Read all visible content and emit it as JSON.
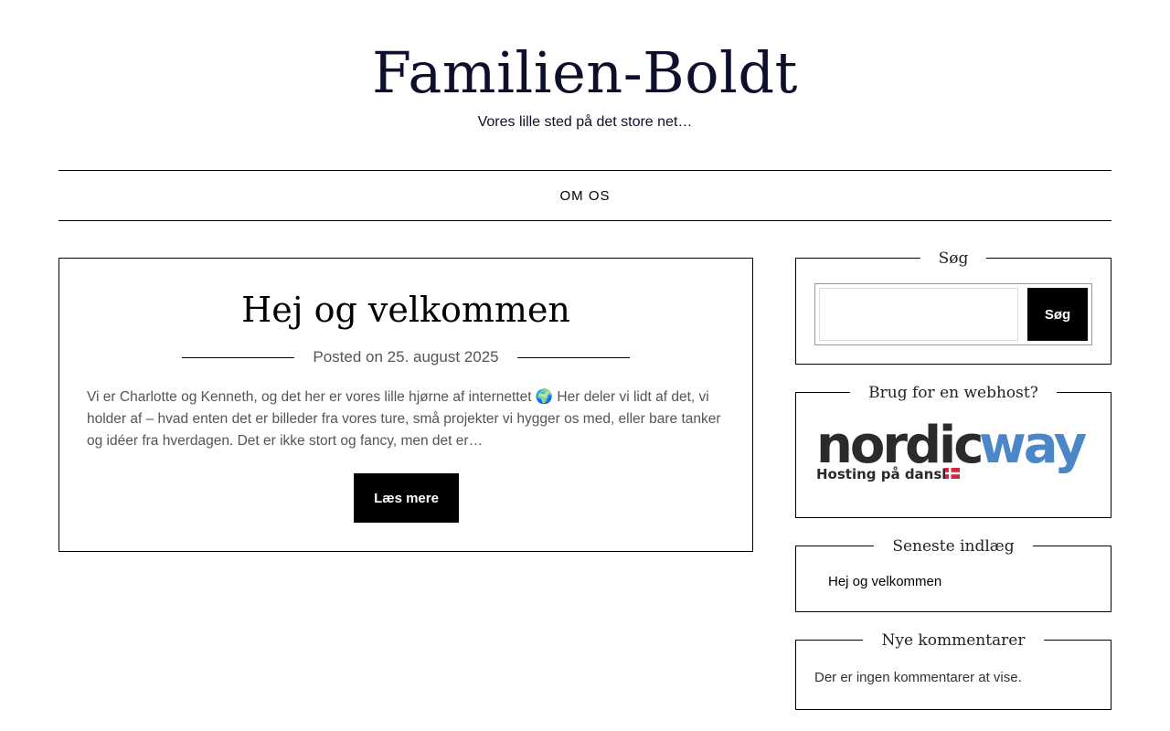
{
  "site": {
    "title": "Familien-Boldt",
    "tagline": "Vores lille sted på det store net…"
  },
  "nav": {
    "items": [
      {
        "label": "OM OS"
      }
    ]
  },
  "post": {
    "title": "Hej og velkommen",
    "meta_prefix": "Posted on",
    "date": "25. august 2025",
    "excerpt": "Vi er Charlotte og Kenneth, og det her er vores lille hjørne af internettet 🌍 Her deler vi lidt af det, vi holder af – hvad enten det er billeder fra vores ture, små projekter vi hygger os med, eller bare tanker og idéer fra hverdagen. Det er ikke stort og fancy, men det er…",
    "read_more_label": "Læs mere"
  },
  "sidebar": {
    "search": {
      "title": "Søg",
      "placeholder": "",
      "button_label": "Søg"
    },
    "webhost": {
      "title": "Brug for en webhost?",
      "logo_word_dark": "nordic",
      "logo_word_blue": "way",
      "logo_tagline": "Hosting på dansk",
      "colors": {
        "dark": "#2b2b2b",
        "blue": "#4a86c8",
        "flag_red": "#d7263d"
      }
    },
    "recent_posts": {
      "title": "Seneste indlæg",
      "items": [
        {
          "label": "Hej og velkommen"
        }
      ]
    },
    "recent_comments": {
      "title": "Nye kommentarer",
      "empty_text": "Der er ingen kommentarer at vise."
    }
  },
  "colors": {
    "title": "#0d0f2b",
    "button_bg": "#000000",
    "button_text": "#ffffff",
    "meta_text": "#555555"
  }
}
